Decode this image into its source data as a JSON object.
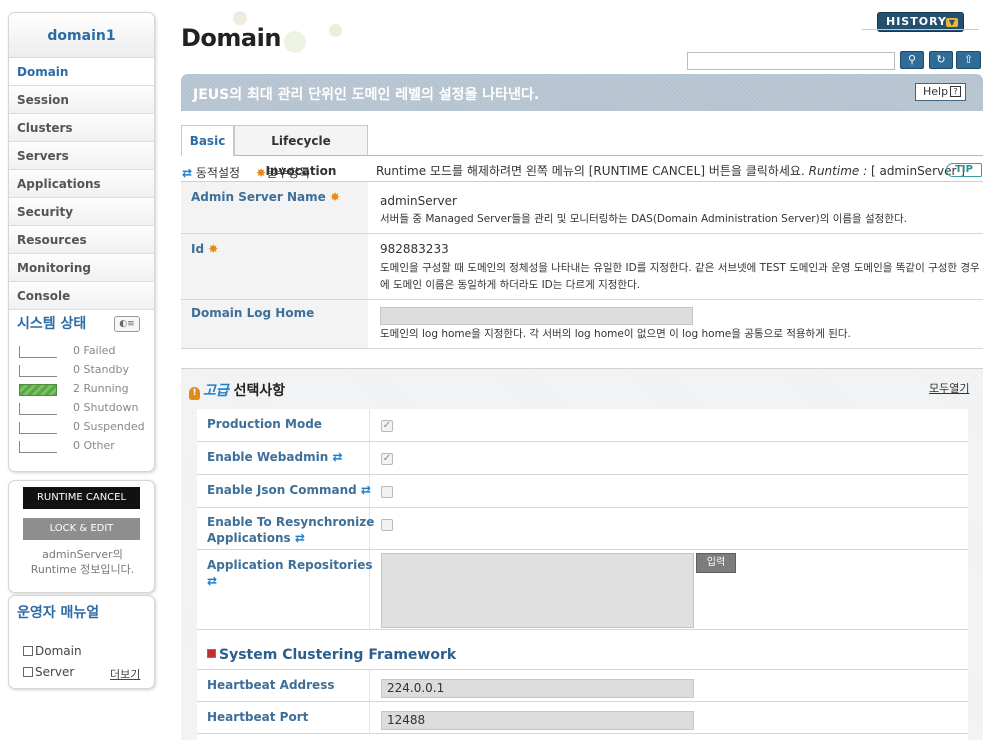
{
  "sidebar": {
    "domain_name": "domain1",
    "nav": [
      "Domain",
      "Session",
      "Clusters",
      "Servers",
      "Applications",
      "Security",
      "Resources",
      "Monitoring",
      "Console"
    ],
    "status_title": "시스템 상태",
    "status": [
      {
        "count": "0",
        "label": "Failed"
      },
      {
        "count": "0",
        "label": "Standby"
      },
      {
        "count": "2",
        "label": "Running"
      },
      {
        "count": "0",
        "label": "Shutdown"
      },
      {
        "count": "0",
        "label": "Suspended"
      },
      {
        "count": "0",
        "label": "Other"
      }
    ],
    "runtime_cancel": "RUNTIME CANCEL",
    "lock_edit": "LOCK & EDIT",
    "runtime_info_line1": "adminServer의",
    "runtime_info_line2": "Runtime 정보입니다.",
    "manual_title": "운영자 매뉴얼",
    "manual_links": [
      "Domain",
      "Server"
    ],
    "more": "더보기"
  },
  "header": {
    "title": "Domain",
    "history": "HISTORY",
    "search_value": "",
    "description": "JEUS의 최대 관리 단위인 도메인 레벨의 설정을 나타낸다.",
    "help": "Help"
  },
  "tabs": [
    "Basic",
    "Lifecycle Invocation"
  ],
  "legend": {
    "dynamic": "동적설정",
    "required": "필수항목",
    "tip": "Runtime 모드를 해제하려면 왼쪽 메뉴의 [RUNTIME CANCEL] 버튼을 클릭하세요.",
    "runtime_label": "Runtime :",
    "runtime_server": "[ adminServer ]",
    "tip_badge": "TIP"
  },
  "basic": {
    "admin_server_name": {
      "label": "Admin Server Name",
      "value": "adminServer",
      "desc": "서버들 중 Managed Server들을 관리 및 모니터링하는 DAS(Domain Administration Server)의 이름을 설정한다."
    },
    "id": {
      "label": "Id",
      "value": "982883233",
      "desc": "도메인을 구성할 때 도메인의 정체성을 나타내는 유일한 ID를 지정한다. 같은 서브넷에 TEST 도메인과 운영 도메인을 똑같이 구성한 경우에 도메인 이름은 동일하게 하더라도 ID는 다르게 지정한다."
    },
    "log_home": {
      "label": "Domain Log Home",
      "value": "",
      "desc": "도메인의 log home을 지정한다. 각 서버의 log home이 없으면 이 log home을 공통으로 적용하게 된다."
    }
  },
  "advanced": {
    "title_accent": "고급",
    "title_rest": " 선택사항",
    "expand_all": "모두열기",
    "production_mode": {
      "label": "Production Mode",
      "checked": true
    },
    "enable_webadmin": {
      "label": "Enable Webadmin",
      "checked": true
    },
    "enable_json_command": {
      "label": "Enable Json Command",
      "checked": false
    },
    "enable_resync": {
      "label_line1": "Enable To Resynchronize",
      "label_line2": "Applications",
      "checked": false
    },
    "app_repos": {
      "label": "Application Repositories",
      "value": "",
      "button": "입력"
    },
    "clustering_title": "System Clustering Framework",
    "heartbeat_address": {
      "label": "Heartbeat Address",
      "value": "224.0.0.1"
    },
    "heartbeat_port": {
      "label": "Heartbeat Port",
      "value": "12488"
    }
  }
}
